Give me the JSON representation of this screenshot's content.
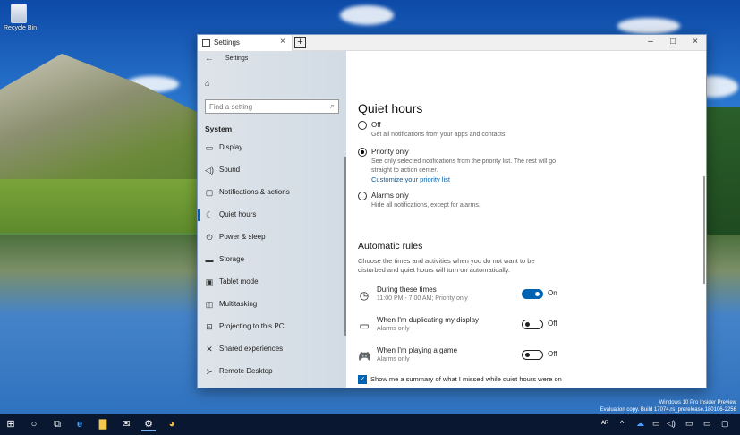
{
  "desktop": {
    "recycle_bin_label": "Recycle Bin",
    "watermark_line1": "Windows 10 Pro Insider Preview",
    "watermark_line2": "Evaluation copy. Build 17074.rs_prerelease.180106-2256"
  },
  "window": {
    "tab_title": "Settings",
    "tab_close": "×",
    "new_tab": "+",
    "minimize": "–",
    "maximize": "□",
    "close": "×"
  },
  "nav": {
    "back_label": "←",
    "title": "Settings",
    "home_icon": "⌂",
    "search_placeholder": "Find a setting",
    "search_icon": "⌕",
    "section": "System",
    "items": [
      {
        "label": "Display",
        "icon": "▭",
        "icon_name": "display-icon"
      },
      {
        "label": "Sound",
        "icon": "◁)",
        "icon_name": "sound-icon"
      },
      {
        "label": "Notifications & actions",
        "icon": "▢",
        "icon_name": "notifications-icon"
      },
      {
        "label": "Quiet hours",
        "icon": "☾",
        "icon_name": "moon-icon"
      },
      {
        "label": "Power & sleep",
        "icon": "⏻",
        "icon_name": "power-icon"
      },
      {
        "label": "Storage",
        "icon": "▬",
        "icon_name": "storage-icon"
      },
      {
        "label": "Tablet mode",
        "icon": "▣",
        "icon_name": "tablet-icon"
      },
      {
        "label": "Multitasking",
        "icon": "◫",
        "icon_name": "multitasking-icon"
      },
      {
        "label": "Projecting to this PC",
        "icon": "⊡",
        "icon_name": "projecting-icon"
      },
      {
        "label": "Shared experiences",
        "icon": "✕",
        "icon_name": "shared-experiences-icon"
      },
      {
        "label": "Remote Desktop",
        "icon": "≻",
        "icon_name": "remote-desktop-icon"
      }
    ],
    "active_index": 3
  },
  "content": {
    "title": "Quiet hours",
    "options": [
      {
        "label": "Off",
        "desc": "Get all notifications from your apps and contacts.",
        "selected": false
      },
      {
        "label": "Priority only",
        "desc": "See only selected notifications from the priority list. The rest will go straight to action center.",
        "link": "Customize your priority list",
        "selected": true
      },
      {
        "label": "Alarms only",
        "desc": "Hide all notifications, except for alarms.",
        "selected": false
      }
    ],
    "auto_title": "Automatic rules",
    "auto_desc": "Choose the times and activities when you do not want to be disturbed and quiet hours will turn on automatically.",
    "rules": [
      {
        "title": "During these times",
        "sub": "11:00 PM - 7:00 AM; Priority only",
        "state": "On",
        "on": true,
        "icon": "◷",
        "icon_name": "clock-icon"
      },
      {
        "title": "When I'm duplicating my display",
        "sub": "Alarms only",
        "state": "Off",
        "on": false,
        "icon": "▭",
        "icon_name": "monitor-icon"
      },
      {
        "title": "When I'm playing a game",
        "sub": "Alarms only",
        "state": "Off",
        "on": false,
        "icon": "🎮",
        "icon_name": "gamepad-icon"
      }
    ],
    "summary_checkbox": "Show me a summary of what I missed while quiet hours were on",
    "summary_checked": true
  },
  "taskbar": {
    "start_icon": "⊞",
    "cortana_icon": "○",
    "taskview_icon": "⧉",
    "edge_icon": "e",
    "explorer_icon": "▇",
    "mail_icon": "✉",
    "settings_icon": "⚙",
    "paint_icon": "◕",
    "tray": [
      "ᴬᴿ",
      "^",
      "☁",
      "▭",
      "◁)",
      "▭",
      "▭",
      "▢"
    ]
  }
}
